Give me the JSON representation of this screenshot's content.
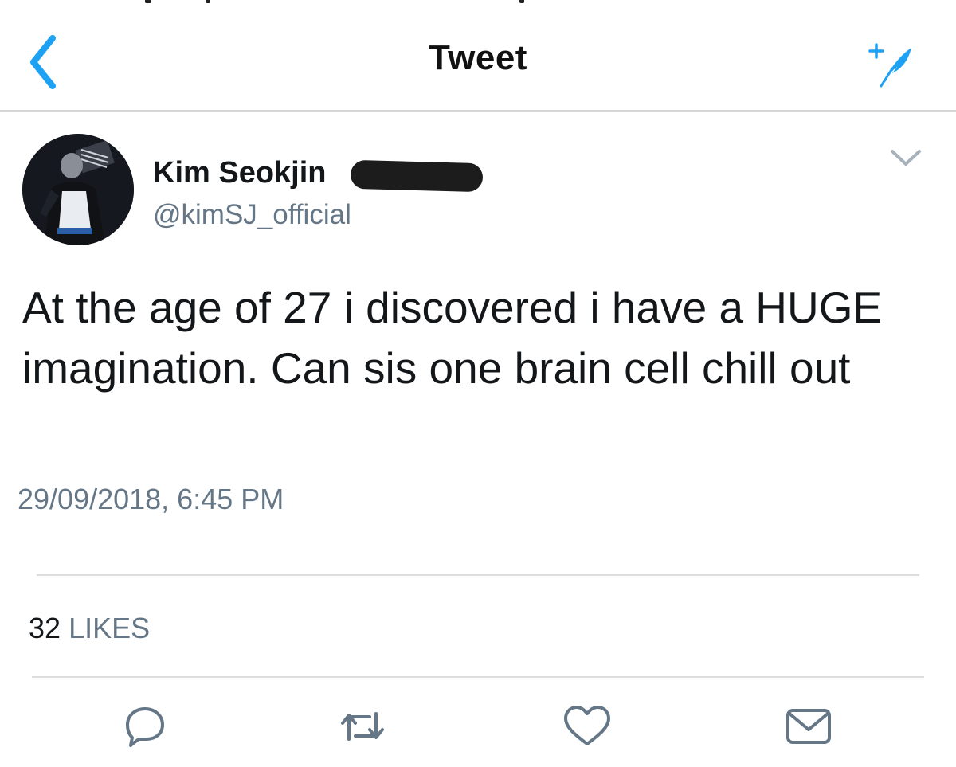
{
  "header": {
    "title": "Tweet",
    "back_icon": "chevron-left-icon",
    "compose_icon": "compose-feather-icon"
  },
  "tweet": {
    "display_name": "Kim Seokjin",
    "handle": "@kimSJ_official",
    "text": "At the age of 27 i discovered i have a HUGE imagination. Can sis one brain cell chill out",
    "timestamp": "29/09/2018, 6:45 PM"
  },
  "stats": {
    "likes_count": "32",
    "likes_label": "LIKES"
  },
  "actions": [
    {
      "name": "reply",
      "icon": "reply-bubble-icon"
    },
    {
      "name": "retweet",
      "icon": "retweet-icon"
    },
    {
      "name": "like",
      "icon": "heart-icon"
    },
    {
      "name": "share",
      "icon": "envelope-icon"
    }
  ],
  "colors": {
    "accent": "#1da1f2",
    "text_primary": "#14171a",
    "text_secondary": "#657786",
    "divider": "#dddddd",
    "icon_gray": "#657786"
  }
}
